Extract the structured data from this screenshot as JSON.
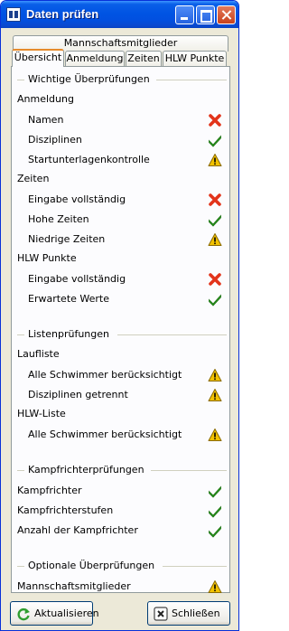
{
  "window": {
    "title": "Daten prüfen"
  },
  "tabs": {
    "row2": "Mannschaftsmitglieder",
    "row1": [
      "Übersicht",
      "Anmeldung",
      "Zeiten",
      "HLW Punkte"
    ],
    "active": "Übersicht"
  },
  "sections": [
    {
      "heading": "Wichtige Überprüfungen",
      "groups": [
        {
          "title": "Anmeldung",
          "items": [
            {
              "label": "Namen",
              "status": "error"
            },
            {
              "label": "Disziplinen",
              "status": "ok"
            },
            {
              "label": "Startunterlagenkontrolle",
              "status": "warning"
            }
          ]
        },
        {
          "title": "Zeiten",
          "items": [
            {
              "label": "Eingabe vollständig",
              "status": "error"
            },
            {
              "label": "Hohe Zeiten",
              "status": "ok"
            },
            {
              "label": "Niedrige Zeiten",
              "status": "warning"
            }
          ]
        },
        {
          "title": "HLW Punkte",
          "items": [
            {
              "label": "Eingabe vollständig",
              "status": "error"
            },
            {
              "label": "Erwartete Werte",
              "status": "ok"
            }
          ]
        }
      ]
    },
    {
      "heading": "Listenprüfungen",
      "groups": [
        {
          "title": "Laufliste",
          "items": [
            {
              "label": "Alle Schwimmer berücksichtigt",
              "status": "warning"
            },
            {
              "label": "Disziplinen getrennt",
              "status": "warning"
            }
          ]
        },
        {
          "title": "HLW-Liste",
          "items": [
            {
              "label": "Alle Schwimmer berücksichtigt",
              "status": "warning"
            }
          ]
        }
      ]
    },
    {
      "heading": "Kampfrichterprüfungen",
      "items": [
        {
          "label": "Kampfrichter",
          "status": "ok"
        },
        {
          "label": "Kampfrichterstufen",
          "status": "ok"
        },
        {
          "label": "Anzahl der Kampfrichter",
          "status": "ok"
        }
      ]
    },
    {
      "heading": "Optionale Überprüfungen",
      "items": [
        {
          "label": "Mannschaftsmitglieder",
          "status": "warning"
        }
      ]
    }
  ],
  "buttons": {
    "refresh": "Aktualisieren",
    "close": "Schließen"
  },
  "status_colors": {
    "ok": "#2fa521",
    "error": "#e2341b",
    "warning": "#f2c200"
  }
}
